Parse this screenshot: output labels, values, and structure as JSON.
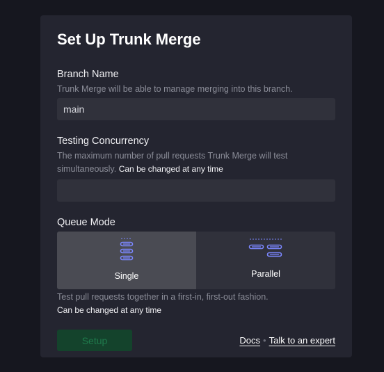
{
  "title": "Set Up Trunk Merge",
  "branch": {
    "label": "Branch Name",
    "help": "Trunk Merge will be able to manage merging into this branch.",
    "value": "main"
  },
  "concurrency": {
    "label": "Testing Concurrency",
    "help": "The maximum number of pull requests Trunk Merge will test simultaneously.",
    "help_emphasis": "Can be changed at any time",
    "value": ""
  },
  "queue_mode": {
    "label": "Queue Mode",
    "options": [
      {
        "label": "Single",
        "icon": "single-queue-icon",
        "selected": true
      },
      {
        "label": "Parallel",
        "icon": "parallel-queue-icon",
        "selected": false
      }
    ],
    "description": "Test pull requests together in a first-in, first-out fashion.",
    "note": "Can be changed at any time"
  },
  "setup_button": {
    "label": "Setup",
    "enabled": false
  },
  "links": {
    "docs": "Docs",
    "separator": "•",
    "expert": "Talk to an expert"
  },
  "colors": {
    "background": "#16171f",
    "card": "#242530",
    "input": "#30313b",
    "selected_segment": "#4a4b53",
    "icon_accent": "#7b87ff",
    "button_disabled_bg": "#14432c",
    "button_disabled_text": "#1f7a4c"
  }
}
